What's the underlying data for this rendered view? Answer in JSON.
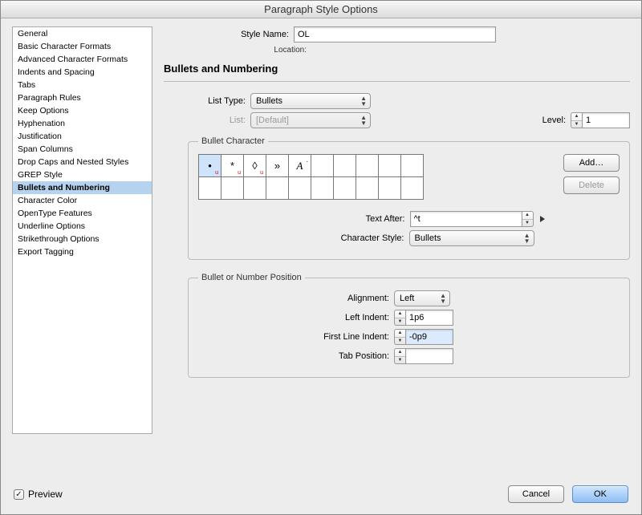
{
  "title": "Paragraph Style Options",
  "sidebar": {
    "items": [
      "General",
      "Basic Character Formats",
      "Advanced Character Formats",
      "Indents and Spacing",
      "Tabs",
      "Paragraph Rules",
      "Keep Options",
      "Hyphenation",
      "Justification",
      "Span Columns",
      "Drop Caps and Nested Styles",
      "GREP Style",
      "Bullets and Numbering",
      "Character Color",
      "OpenType Features",
      "Underline Options",
      "Strikethrough Options",
      "Export Tagging"
    ],
    "selectedIndex": 12
  },
  "header": {
    "styleNameLabel": "Style Name:",
    "styleNameValue": "OL",
    "locationLabel": "Location:",
    "sectionTitle": "Bullets and Numbering"
  },
  "listType": {
    "label": "List Type:",
    "value": "Bullets"
  },
  "list": {
    "label": "List:",
    "value": "[Default]"
  },
  "level": {
    "label": "Level:",
    "value": "1"
  },
  "bulletChar": {
    "legend": "Bullet Character",
    "cells": [
      "•",
      "*",
      "◊",
      "»",
      "A"
    ],
    "addLabel": "Add…",
    "deleteLabel": "Delete"
  },
  "textAfter": {
    "label": "Text After:",
    "value": "^t"
  },
  "charStyle": {
    "label": "Character Style:",
    "value": "Bullets"
  },
  "position": {
    "legend": "Bullet or Number Position",
    "alignmentLabel": "Alignment:",
    "alignmentValue": "Left",
    "leftIndentLabel": "Left Indent:",
    "leftIndentValue": "1p6",
    "firstLineLabel": "First Line Indent:",
    "firstLineValue": "-0p9",
    "tabPosLabel": "Tab Position:",
    "tabPosValue": ""
  },
  "footer": {
    "previewLabel": "Preview",
    "previewChecked": true,
    "cancelLabel": "Cancel",
    "okLabel": "OK"
  }
}
